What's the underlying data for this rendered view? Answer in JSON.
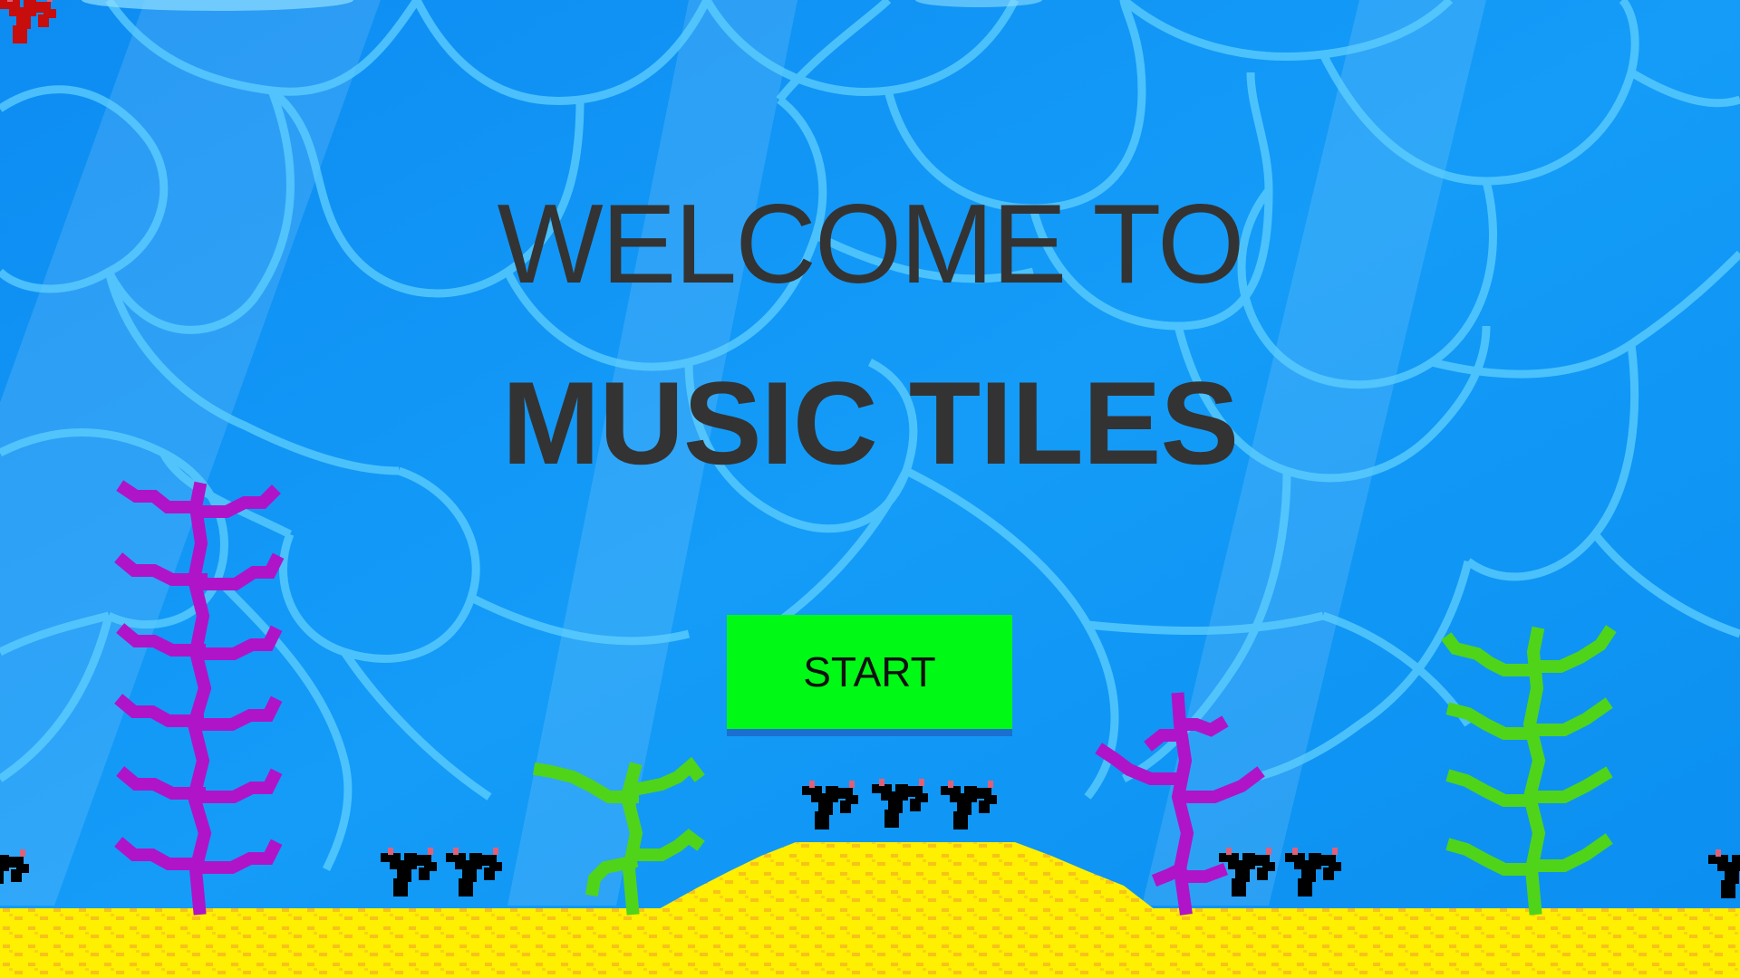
{
  "title": {
    "line1": "WELCOME TO",
    "line2": "MUSIC TILES"
  },
  "start_button": {
    "label": "START"
  },
  "colors": {
    "water": "#0b96f6",
    "caustics": "#5fd0ff",
    "sand": "#ffef00",
    "sand_speckle": "#f7c21a",
    "button": "#00fa16",
    "title_text": "#333333",
    "purple_seaweed": "#b014c8",
    "green_seaweed": "#4fd41a",
    "red_coral": "#c80d0d"
  },
  "icons": [
    "purple-seaweed-icon",
    "green-seaweed-icon",
    "red-coral-icon"
  ]
}
